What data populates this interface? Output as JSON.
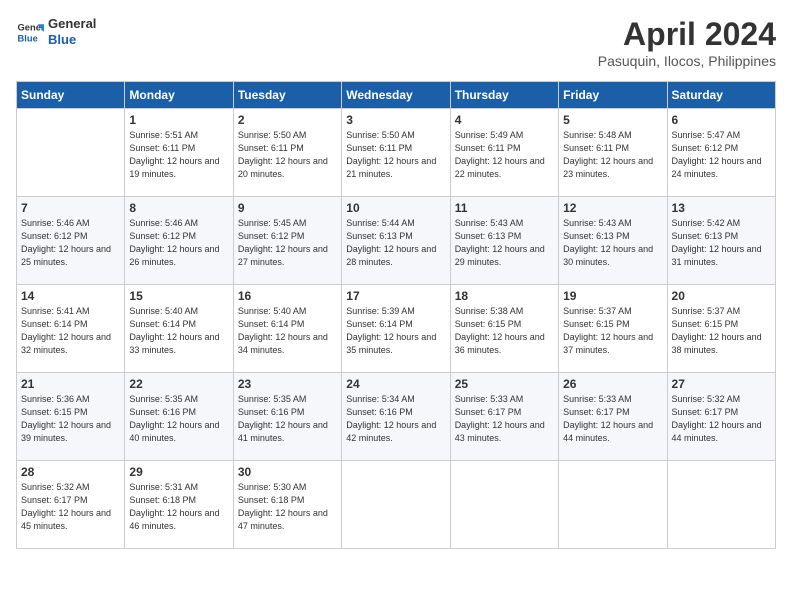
{
  "logo": {
    "text_general": "General",
    "text_blue": "Blue"
  },
  "header": {
    "title": "April 2024",
    "subtitle": "Pasuquin, Ilocos, Philippines"
  },
  "columns": [
    "Sunday",
    "Monday",
    "Tuesday",
    "Wednesday",
    "Thursday",
    "Friday",
    "Saturday"
  ],
  "weeks": [
    [
      {
        "day": "",
        "sunrise": "",
        "sunset": "",
        "daylight": ""
      },
      {
        "day": "1",
        "sunrise": "Sunrise: 5:51 AM",
        "sunset": "Sunset: 6:11 PM",
        "daylight": "Daylight: 12 hours and 19 minutes."
      },
      {
        "day": "2",
        "sunrise": "Sunrise: 5:50 AM",
        "sunset": "Sunset: 6:11 PM",
        "daylight": "Daylight: 12 hours and 20 minutes."
      },
      {
        "day": "3",
        "sunrise": "Sunrise: 5:50 AM",
        "sunset": "Sunset: 6:11 PM",
        "daylight": "Daylight: 12 hours and 21 minutes."
      },
      {
        "day": "4",
        "sunrise": "Sunrise: 5:49 AM",
        "sunset": "Sunset: 6:11 PM",
        "daylight": "Daylight: 12 hours and 22 minutes."
      },
      {
        "day": "5",
        "sunrise": "Sunrise: 5:48 AM",
        "sunset": "Sunset: 6:11 PM",
        "daylight": "Daylight: 12 hours and 23 minutes."
      },
      {
        "day": "6",
        "sunrise": "Sunrise: 5:47 AM",
        "sunset": "Sunset: 6:12 PM",
        "daylight": "Daylight: 12 hours and 24 minutes."
      }
    ],
    [
      {
        "day": "7",
        "sunrise": "Sunrise: 5:46 AM",
        "sunset": "Sunset: 6:12 PM",
        "daylight": "Daylight: 12 hours and 25 minutes."
      },
      {
        "day": "8",
        "sunrise": "Sunrise: 5:46 AM",
        "sunset": "Sunset: 6:12 PM",
        "daylight": "Daylight: 12 hours and 26 minutes."
      },
      {
        "day": "9",
        "sunrise": "Sunrise: 5:45 AM",
        "sunset": "Sunset: 6:12 PM",
        "daylight": "Daylight: 12 hours and 27 minutes."
      },
      {
        "day": "10",
        "sunrise": "Sunrise: 5:44 AM",
        "sunset": "Sunset: 6:13 PM",
        "daylight": "Daylight: 12 hours and 28 minutes."
      },
      {
        "day": "11",
        "sunrise": "Sunrise: 5:43 AM",
        "sunset": "Sunset: 6:13 PM",
        "daylight": "Daylight: 12 hours and 29 minutes."
      },
      {
        "day": "12",
        "sunrise": "Sunrise: 5:43 AM",
        "sunset": "Sunset: 6:13 PM",
        "daylight": "Daylight: 12 hours and 30 minutes."
      },
      {
        "day": "13",
        "sunrise": "Sunrise: 5:42 AM",
        "sunset": "Sunset: 6:13 PM",
        "daylight": "Daylight: 12 hours and 31 minutes."
      }
    ],
    [
      {
        "day": "14",
        "sunrise": "Sunrise: 5:41 AM",
        "sunset": "Sunset: 6:14 PM",
        "daylight": "Daylight: 12 hours and 32 minutes."
      },
      {
        "day": "15",
        "sunrise": "Sunrise: 5:40 AM",
        "sunset": "Sunset: 6:14 PM",
        "daylight": "Daylight: 12 hours and 33 minutes."
      },
      {
        "day": "16",
        "sunrise": "Sunrise: 5:40 AM",
        "sunset": "Sunset: 6:14 PM",
        "daylight": "Daylight: 12 hours and 34 minutes."
      },
      {
        "day": "17",
        "sunrise": "Sunrise: 5:39 AM",
        "sunset": "Sunset: 6:14 PM",
        "daylight": "Daylight: 12 hours and 35 minutes."
      },
      {
        "day": "18",
        "sunrise": "Sunrise: 5:38 AM",
        "sunset": "Sunset: 6:15 PM",
        "daylight": "Daylight: 12 hours and 36 minutes."
      },
      {
        "day": "19",
        "sunrise": "Sunrise: 5:37 AM",
        "sunset": "Sunset: 6:15 PM",
        "daylight": "Daylight: 12 hours and 37 minutes."
      },
      {
        "day": "20",
        "sunrise": "Sunrise: 5:37 AM",
        "sunset": "Sunset: 6:15 PM",
        "daylight": "Daylight: 12 hours and 38 minutes."
      }
    ],
    [
      {
        "day": "21",
        "sunrise": "Sunrise: 5:36 AM",
        "sunset": "Sunset: 6:15 PM",
        "daylight": "Daylight: 12 hours and 39 minutes."
      },
      {
        "day": "22",
        "sunrise": "Sunrise: 5:35 AM",
        "sunset": "Sunset: 6:16 PM",
        "daylight": "Daylight: 12 hours and 40 minutes."
      },
      {
        "day": "23",
        "sunrise": "Sunrise: 5:35 AM",
        "sunset": "Sunset: 6:16 PM",
        "daylight": "Daylight: 12 hours and 41 minutes."
      },
      {
        "day": "24",
        "sunrise": "Sunrise: 5:34 AM",
        "sunset": "Sunset: 6:16 PM",
        "daylight": "Daylight: 12 hours and 42 minutes."
      },
      {
        "day": "25",
        "sunrise": "Sunrise: 5:33 AM",
        "sunset": "Sunset: 6:17 PM",
        "daylight": "Daylight: 12 hours and 43 minutes."
      },
      {
        "day": "26",
        "sunrise": "Sunrise: 5:33 AM",
        "sunset": "Sunset: 6:17 PM",
        "daylight": "Daylight: 12 hours and 44 minutes."
      },
      {
        "day": "27",
        "sunrise": "Sunrise: 5:32 AM",
        "sunset": "Sunset: 6:17 PM",
        "daylight": "Daylight: 12 hours and 44 minutes."
      }
    ],
    [
      {
        "day": "28",
        "sunrise": "Sunrise: 5:32 AM",
        "sunset": "Sunset: 6:17 PM",
        "daylight": "Daylight: 12 hours and 45 minutes."
      },
      {
        "day": "29",
        "sunrise": "Sunrise: 5:31 AM",
        "sunset": "Sunset: 6:18 PM",
        "daylight": "Daylight: 12 hours and 46 minutes."
      },
      {
        "day": "30",
        "sunrise": "Sunrise: 5:30 AM",
        "sunset": "Sunset: 6:18 PM",
        "daylight": "Daylight: 12 hours and 47 minutes."
      },
      {
        "day": "",
        "sunrise": "",
        "sunset": "",
        "daylight": ""
      },
      {
        "day": "",
        "sunrise": "",
        "sunset": "",
        "daylight": ""
      },
      {
        "day": "",
        "sunrise": "",
        "sunset": "",
        "daylight": ""
      },
      {
        "day": "",
        "sunrise": "",
        "sunset": "",
        "daylight": ""
      }
    ]
  ]
}
